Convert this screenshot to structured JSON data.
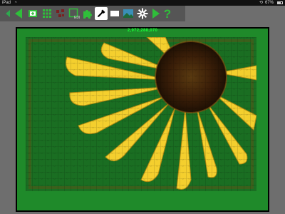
{
  "status_bar": {
    "carrier": "iPad",
    "time": "",
    "battery": "67%"
  },
  "toolbar": {
    "buttons": [
      {
        "name": "prev-arrow-small-icon",
        "color": "#2fa84f"
      },
      {
        "name": "prev-arrow-icon",
        "color": "#2fbf3a"
      },
      {
        "name": "add-piece-icon",
        "color": "#2fbf3a"
      },
      {
        "name": "grid-icon",
        "color": "#2fbf3a"
      },
      {
        "name": "scatter-icon",
        "color": "#7a2020"
      },
      {
        "name": "edge-pieces-icon",
        "color": "#2fbf3a"
      },
      {
        "name": "puzzle-piece-icon",
        "color": "#2fbf3a"
      },
      {
        "name": "eyedropper-icon",
        "color": "#000000"
      },
      {
        "name": "background-color-icon",
        "color": "#ffffff"
      },
      {
        "name": "preview-image-icon",
        "color": "#3a8fb7"
      },
      {
        "name": "settings-gear-icon",
        "color": "#ffffff"
      },
      {
        "name": "next-arrow-icon",
        "color": "#2fbf3a"
      },
      {
        "name": "help-icon",
        "color": "#2fbf3a"
      }
    ]
  },
  "board": {
    "piece_count": "2,972,288,070",
    "background_color": "#1f8a2a",
    "count_color": "#1aff3a"
  },
  "colors": {
    "board_green": "#1f8a2a",
    "app_gray": "#6e6e6e",
    "toolbar_gray": "#555555",
    "petal_yellow": "#f4cf2e",
    "center_brown": "#3a1e08"
  }
}
